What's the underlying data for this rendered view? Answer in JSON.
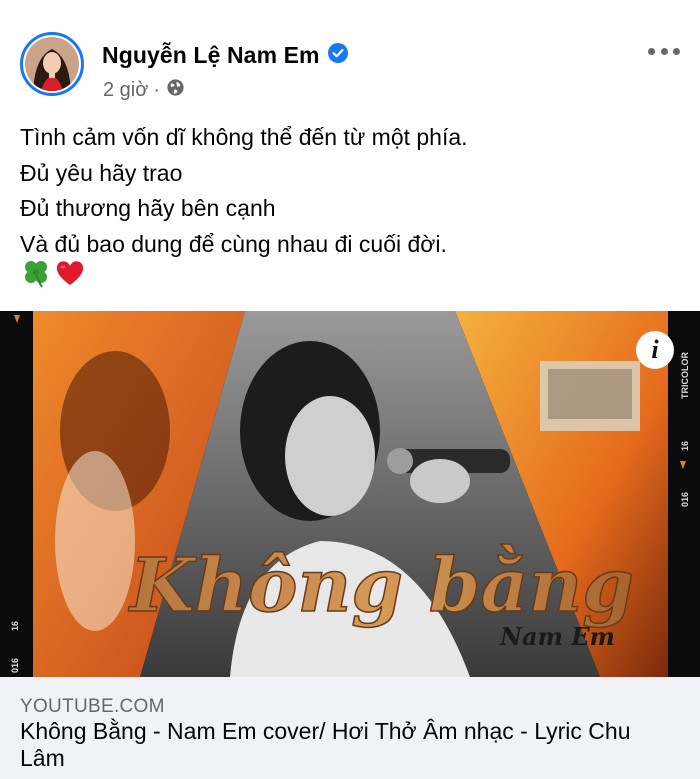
{
  "post": {
    "author": "Nguyễn Lệ Nam Em",
    "time": "2 giờ",
    "separator": "·",
    "privacy_icon": "globe-icon",
    "verified_icon": "verified-badge-icon",
    "more_icon": "more-options-icon",
    "text_lines": [
      "Tình cảm vốn dĩ không thể đến từ một phía.",
      "Đủ yêu hãy trao",
      "Đủ thương hãy bên cạnh",
      "Và đủ bao dung để cùng nhau đi cuối đời."
    ],
    "emojis": [
      "four-leaf-clover-icon",
      "red-heart-icon"
    ]
  },
  "media": {
    "thumbnail_title": "Không bằng",
    "thumbnail_artist": "Nam Em",
    "side_text_right": [
      "TRICOLOR",
      "16",
      "016"
    ],
    "side_text_left": [
      "16",
      "016"
    ],
    "info_label": "i"
  },
  "link": {
    "domain": "YOUTUBE.COM",
    "title": "Không Bằng - Nam Em cover/ Hơi Thở Âm nhạc - Lyric Chu Lâm"
  },
  "colors": {
    "accent": "#1877f2",
    "secondary_text": "#65676b",
    "card_bg": "#f0f2f5",
    "thumb_orange": "#e8731f"
  }
}
